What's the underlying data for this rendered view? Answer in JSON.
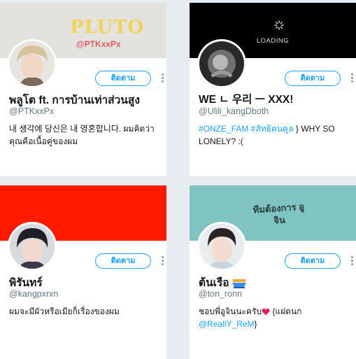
{
  "follow_label": "ติดตาม",
  "cards": [
    {
      "name": "พลูโต ft. การบ้านเท่าส่วนสูง",
      "handle": "@PTKxxPx",
      "bio": "내 생각에 당신은 내 영혼합니다. ผมคิดว่าคุณคือเนื้อคู่ของผม",
      "banner": {
        "title": "PLUTO",
        "subtitle": "@PTKxxPx",
        "color": "#e4e2dd"
      }
    },
    {
      "name": "WE ㄴ 우리 ㅡ XXX!",
      "handle": "@Ulili_kangDboth",
      "bio_links": "#ONZE_FAM #ลัทธิคนคูล",
      "bio_rest": " } WHY SO LONELY? :(",
      "banner": {
        "loading_text": "LOADING",
        "color": "#000000"
      }
    },
    {
      "name": "พิรันทร์",
      "handle": "@kangpxrxn",
      "bio": "ผมจะมีผัวหรือเมียก็เรื่องของผม",
      "banner": {
        "color": "#ff1a00"
      }
    },
    {
      "name": "ต้นเรือ",
      "name_emoji": "boat-emoji",
      "handle": "@ton_ronn",
      "bio_text": "ชอบพี่อูจินนะครับ",
      "bio_emoji": "heart-emoji",
      "bio_after": " {แฝดนก ",
      "bio_link": "@ReallY_ReM",
      "bio_end": "}",
      "banner": {
        "text": "ทีมต้องการ อูจิน",
        "color": "#7fc4c0"
      }
    }
  ]
}
